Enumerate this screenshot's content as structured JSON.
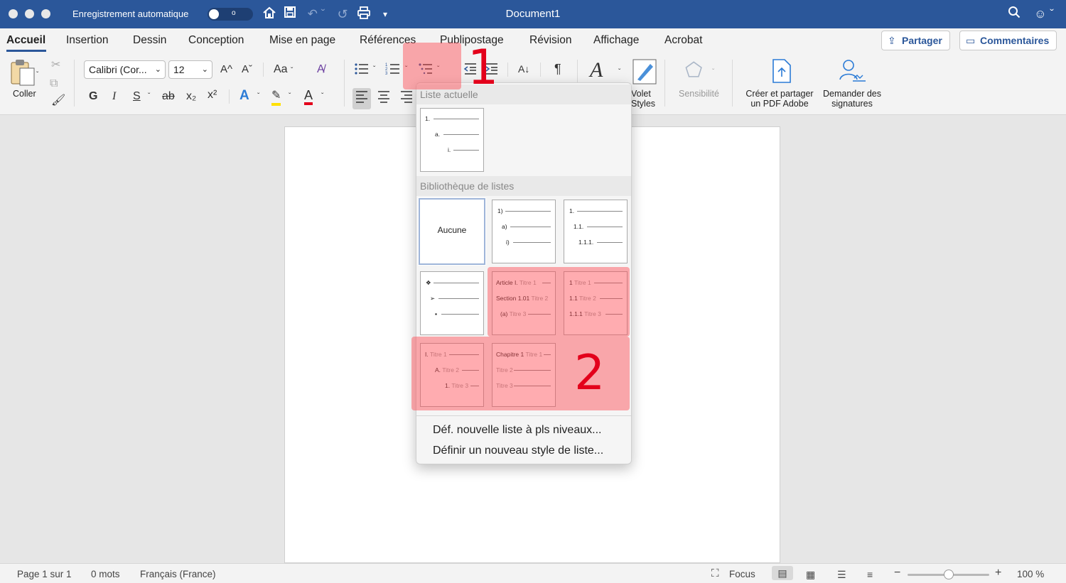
{
  "titlebar": {
    "autosave_label": "Enregistrement automatique",
    "autosave_state": "o",
    "doc_title": "Document1",
    "bg_color": "#2b579a"
  },
  "tabs": [
    {
      "label": "Accueil",
      "active": true
    },
    {
      "label": "Insertion"
    },
    {
      "label": "Dessin"
    },
    {
      "label": "Conception"
    },
    {
      "label": "Mise en page"
    },
    {
      "label": "Références"
    },
    {
      "label": "Publipostage"
    },
    {
      "label": "Révision"
    },
    {
      "label": "Affichage"
    },
    {
      "label": "Acrobat"
    }
  ],
  "header_buttons": {
    "share": "Partager",
    "comments": "Commentaires"
  },
  "ribbon": {
    "paste": "Coller",
    "font_name": "Calibri (Cor...",
    "font_size": "12",
    "bold": "G",
    "italic": "I",
    "underline": "S",
    "strike": "ab",
    "subscript": "x₂",
    "superscript": "x²",
    "grow_font": "A^",
    "shrink_font": "Aˇ",
    "change_case": "Aa",
    "text_effects": "A",
    "highlight": "✎",
    "font_color": "A",
    "styles_pane_1": "Volet",
    "styles_pane_2": "Styles",
    "sensitivity": "Sensibilité",
    "adobe_1": "Créer et partager",
    "adobe_2": "un PDF Adobe",
    "sign_1": "Demander des",
    "sign_2": "signatures"
  },
  "dropdown": {
    "current_header": "Liste actuelle",
    "library_header": "Bibliothèque de listes",
    "current_thumb": [
      "1.",
      "a.",
      "i."
    ],
    "none_label": "Aucune",
    "thumb_paren": [
      "1)",
      "a)",
      "i)"
    ],
    "thumb_decimal": [
      "1.",
      "1.1.",
      "1.1.1."
    ],
    "thumb_bullets": [
      "❖",
      "➢",
      "▪"
    ],
    "thumb_article": [
      {
        "b": "Article I.",
        "g": "Titre 1"
      },
      {
        "b": "Section 1.01",
        "g": "Titre 2"
      },
      {
        "b": "(a)",
        "g": "Titre 3"
      }
    ],
    "thumb_heading_num": [
      {
        "b": "1",
        "g": "Titre 1"
      },
      {
        "b": "1.1",
        "g": "Titre 2"
      },
      {
        "b": "1.1.1",
        "g": "Titre 3"
      }
    ],
    "thumb_roman": [
      {
        "b": "I.",
        "g": "Titre 1"
      },
      {
        "b": "A.",
        "g": "Titre 2"
      },
      {
        "b": "1.",
        "g": "Titre 3"
      }
    ],
    "thumb_chapter": [
      {
        "b": "Chapitre 1",
        "g": "Titre 1"
      },
      {
        "b": "",
        "g": "Titre 2"
      },
      {
        "b": "",
        "g": "Titre 3"
      }
    ],
    "menu_new_multilevel": "Déf. nouvelle liste à pls niveaux...",
    "menu_new_style": "Définir un nouveau style de liste..."
  },
  "annotations": {
    "marker_1": "1",
    "marker_2": "2",
    "color": "#e3001b"
  },
  "status": {
    "page": "Page 1 sur 1",
    "words": "0 mots",
    "language": "Français (France)",
    "focus": "Focus",
    "zoom": "100 %",
    "zoom_level": 100
  }
}
